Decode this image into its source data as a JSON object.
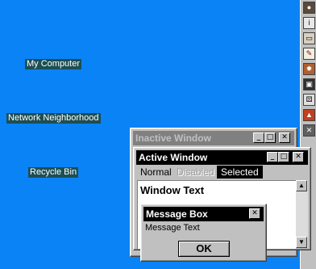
{
  "desktop": {
    "icons": [
      {
        "label": "My Computer"
      },
      {
        "label": "Network Neighborhood"
      },
      {
        "label": "Recycle Bin"
      }
    ]
  },
  "inactive_window": {
    "title": "Inactive Window"
  },
  "active_window": {
    "title": "Active Window",
    "menu": {
      "normal": "Normal",
      "disabled": "Disabled",
      "selected": "Selected"
    },
    "body_text": "Window Text"
  },
  "message_box": {
    "title": "Message Box",
    "text": "Message Text",
    "ok_label": "OK"
  },
  "titlebar_buttons": {
    "minimize": "_",
    "maximize": "□",
    "close": "✕"
  },
  "quick_launch": {
    "icons": [
      "globe-icon",
      "info-icon",
      "keyboard-icon",
      "notepad-icon",
      "settings-icon",
      "display-icon",
      "dice-icon",
      "paint-icon",
      "tools-icon"
    ]
  },
  "colors": {
    "desktop": "#0a83f6",
    "active_title": "#000000",
    "inactive_title": "#808080",
    "selected_bg": "#000000",
    "face": "#c0c0c0"
  }
}
